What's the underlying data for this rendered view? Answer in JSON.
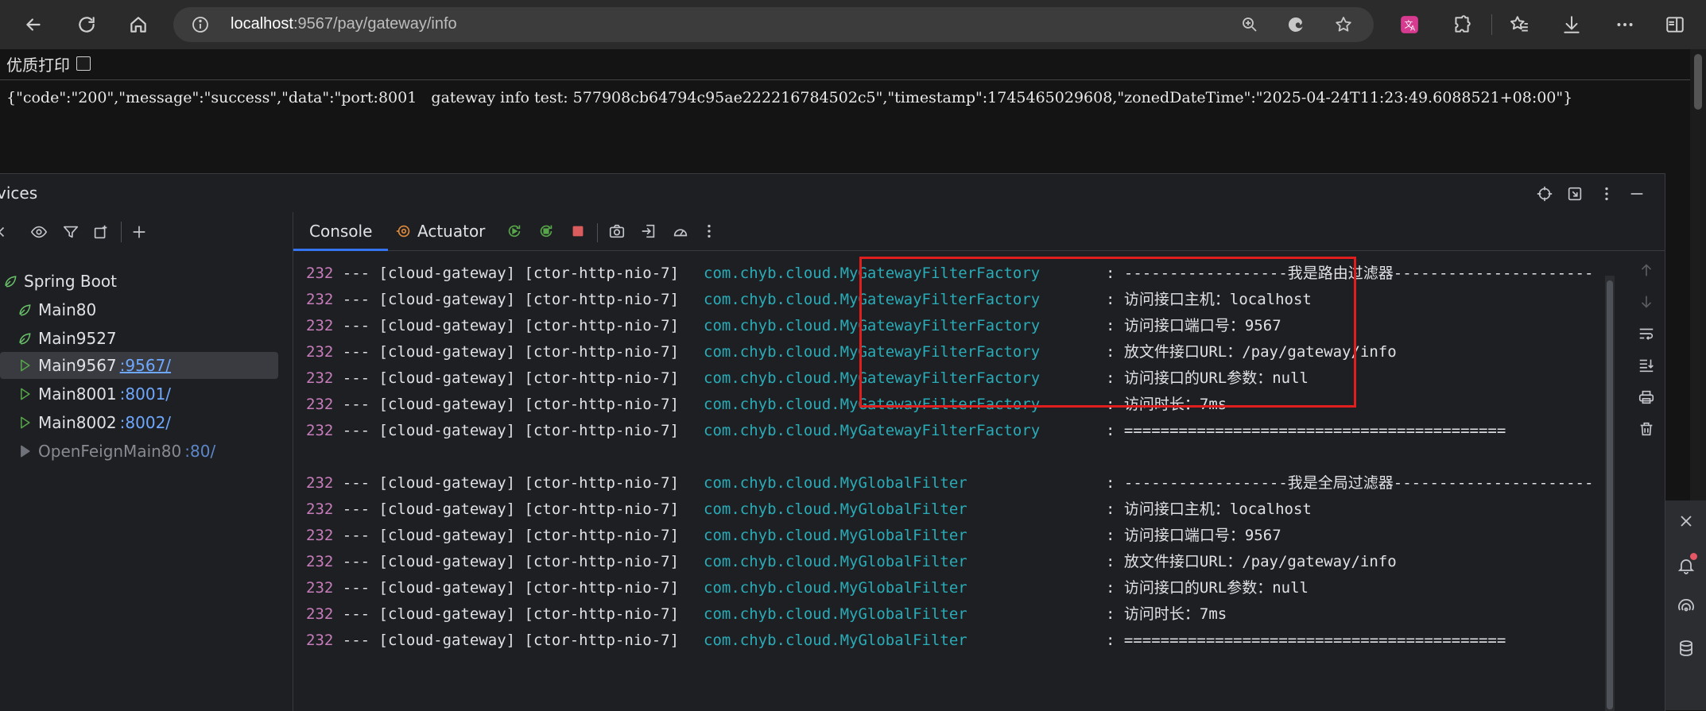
{
  "browser": {
    "url_host": "localhost",
    "url_path": ":9567/pay/gateway/info"
  },
  "page": {
    "print_label": "优质打印",
    "json_text": "{\"code\":\"200\",\"message\":\"success\",\"data\":\"port:8001   gateway info test: 577908cb64794c95ae222216784502c5\",\"timestamp\":1745465029608,\"zonedDateTime\":\"2025-04-24T11:23:49.6088521+08:00\"}"
  },
  "ide": {
    "title": "vices",
    "tabs": {
      "console": "Console",
      "actuator": "Actuator"
    },
    "tree": [
      {
        "label": "Spring Boot",
        "port": ""
      },
      {
        "label": "Main80",
        "port": ""
      },
      {
        "label": "Main9527",
        "port": ""
      },
      {
        "label": "Main9567",
        "port": ":9567/"
      },
      {
        "label": "Main8001",
        "port": ":8001/"
      },
      {
        "label": "Main8002",
        "port": ":8002/"
      },
      {
        "label": "OpenFeignMain80",
        "port": ":80/"
      }
    ],
    "log_lines": [
      {
        "pid": "232",
        "mid": " --- [cloud-gateway] [ctor-http-nio-7] ",
        "logger": "com.chyb.cloud.MyGatewayFilterFactory",
        "msg": ": ------------------我是路由过滤器----------------------"
      },
      {
        "pid": "232",
        "mid": " --- [cloud-gateway] [ctor-http-nio-7] ",
        "logger": "com.chyb.cloud.MyGatewayFilterFactory",
        "msg": ": 访问接口主机：localhost"
      },
      {
        "pid": "232",
        "mid": " --- [cloud-gateway] [ctor-http-nio-7] ",
        "logger": "com.chyb.cloud.MyGatewayFilterFactory",
        "msg": ": 访问接口端口号：9567"
      },
      {
        "pid": "232",
        "mid": " --- [cloud-gateway] [ctor-http-nio-7] ",
        "logger": "com.chyb.cloud.MyGatewayFilterFactory",
        "msg": ": 放文件接口URL：/pay/gateway/info"
      },
      {
        "pid": "232",
        "mid": " --- [cloud-gateway] [ctor-http-nio-7] ",
        "logger": "com.chyb.cloud.MyGatewayFilterFactory",
        "msg": ": 访问接口的URL参数：null"
      },
      {
        "pid": "232",
        "mid": " --- [cloud-gateway] [ctor-http-nio-7] ",
        "logger": "com.chyb.cloud.MyGatewayFilterFactory",
        "msg": ": 访问时长：7ms"
      },
      {
        "pid": "232",
        "mid": " --- [cloud-gateway] [ctor-http-nio-7] ",
        "logger": "com.chyb.cloud.MyGatewayFilterFactory",
        "msg": ": =========================================="
      },
      {
        "pid": "",
        "mid": "",
        "logger": "",
        "msg": ""
      },
      {
        "pid": "232",
        "mid": " --- [cloud-gateway] [ctor-http-nio-7] ",
        "logger": "com.chyb.cloud.MyGlobalFilter",
        "msg": ": ------------------我是全局过滤器----------------------"
      },
      {
        "pid": "232",
        "mid": " --- [cloud-gateway] [ctor-http-nio-7] ",
        "logger": "com.chyb.cloud.MyGlobalFilter",
        "msg": ": 访问接口主机：localhost"
      },
      {
        "pid": "232",
        "mid": " --- [cloud-gateway] [ctor-http-nio-7] ",
        "logger": "com.chyb.cloud.MyGlobalFilter",
        "msg": ": 访问接口端口号：9567"
      },
      {
        "pid": "232",
        "mid": " --- [cloud-gateway] [ctor-http-nio-7] ",
        "logger": "com.chyb.cloud.MyGlobalFilter",
        "msg": ": 放文件接口URL：/pay/gateway/info"
      },
      {
        "pid": "232",
        "mid": " --- [cloud-gateway] [ctor-http-nio-7] ",
        "logger": "com.chyb.cloud.MyGlobalFilter",
        "msg": ": 访问接口的URL参数：null"
      },
      {
        "pid": "232",
        "mid": " --- [cloud-gateway] [ctor-http-nio-7] ",
        "logger": "com.chyb.cloud.MyGlobalFilter",
        "msg": ": 访问时长：7ms"
      },
      {
        "pid": "232",
        "mid": " --- [cloud-gateway] [ctor-http-nio-7] ",
        "logger": "com.chyb.cloud.MyGlobalFilter",
        "msg": ": =========================================="
      }
    ]
  },
  "colors": {
    "highlight_box": "#e01e1e",
    "logger_teal": "#2aacb8",
    "pid_purple": "#c77dbb",
    "port_link": "#6ea8fe",
    "tab_underline": "#3574f0"
  },
  "icons": {
    "browser": [
      "back-icon",
      "refresh-icon",
      "home-icon",
      "info-icon",
      "zoom-in-icon",
      "edge-app-icon",
      "star-icon",
      "translate-icon",
      "extensions-icon",
      "favorites-icon",
      "download-icon",
      "more-icon",
      "sidebar-icon"
    ],
    "ide": [
      "target-icon",
      "expand-window-icon",
      "more-vertical-icon",
      "minimize-icon",
      "eye-icon",
      "filter-icon",
      "new-config-icon",
      "add-icon",
      "rerun-icon",
      "restart-icon",
      "stop-icon",
      "screenshot-icon",
      "export-icon",
      "gauge-icon",
      "scroll-up-icon",
      "scroll-down-icon",
      "soft-wrap-icon",
      "scroll-end-icon",
      "print-icon",
      "trash-icon",
      "close-icon",
      "notifications-icon",
      "ai-assistant-icon",
      "database-icon"
    ]
  }
}
